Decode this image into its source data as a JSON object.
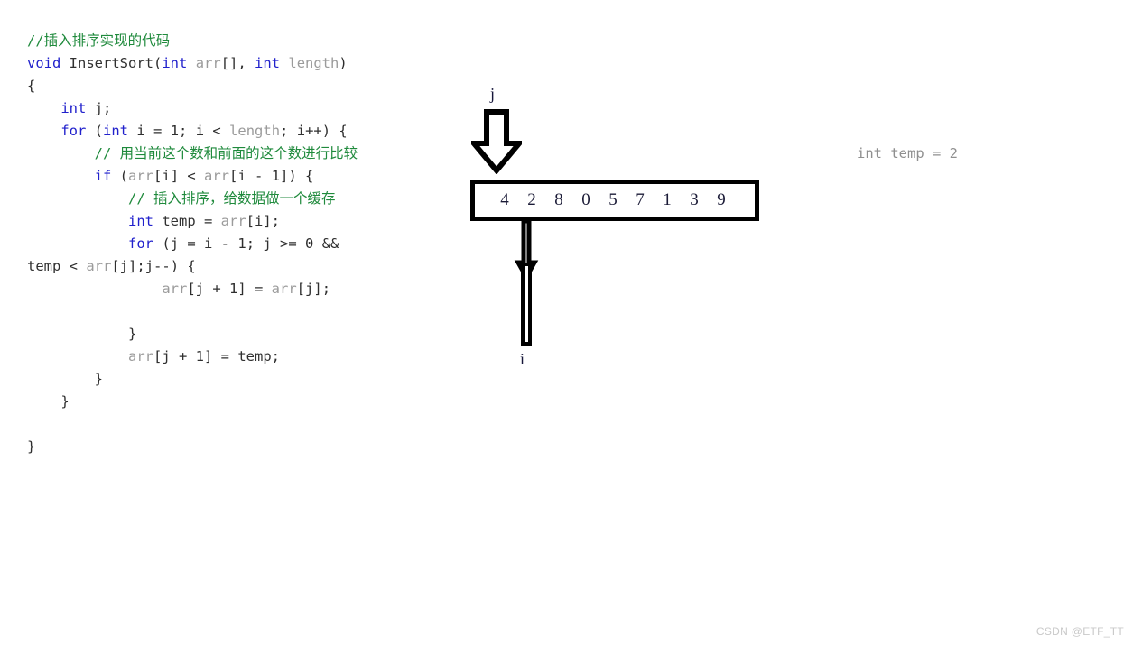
{
  "code": {
    "language": "c",
    "lines": [
      [
        {
          "t": "//插入排序实现的代码",
          "c": "cmt"
        }
      ],
      [
        {
          "t": "void",
          "c": "kw"
        },
        {
          "t": " ",
          "c": "pl"
        },
        {
          "t": "InsertSort",
          "c": "fn"
        },
        {
          "t": "(",
          "c": "pl"
        },
        {
          "t": "int",
          "c": "kw"
        },
        {
          "t": " ",
          "c": "pl"
        },
        {
          "t": "arr",
          "c": "id"
        },
        {
          "t": "[], ",
          "c": "pl"
        },
        {
          "t": "int",
          "c": "kw"
        },
        {
          "t": " ",
          "c": "pl"
        },
        {
          "t": "length",
          "c": "id"
        },
        {
          "t": ")",
          "c": "pl"
        }
      ],
      [
        {
          "t": "{",
          "c": "pl"
        }
      ],
      [
        {
          "t": "    ",
          "c": "pl"
        },
        {
          "t": "int",
          "c": "kw"
        },
        {
          "t": " ",
          "c": "pl"
        },
        {
          "t": "j",
          "c": "fn"
        },
        {
          "t": ";",
          "c": "pl"
        }
      ],
      [
        {
          "t": "    ",
          "c": "pl"
        },
        {
          "t": "for",
          "c": "kw"
        },
        {
          "t": " (",
          "c": "pl"
        },
        {
          "t": "int",
          "c": "kw"
        },
        {
          "t": " ",
          "c": "pl"
        },
        {
          "t": "i",
          "c": "fn"
        },
        {
          "t": " = ",
          "c": "pl"
        },
        {
          "t": "1",
          "c": "num"
        },
        {
          "t": "; ",
          "c": "pl"
        },
        {
          "t": "i",
          "c": "fn"
        },
        {
          "t": " < ",
          "c": "pl"
        },
        {
          "t": "length",
          "c": "id"
        },
        {
          "t": "; ",
          "c": "pl"
        },
        {
          "t": "i",
          "c": "fn"
        },
        {
          "t": "++) {",
          "c": "pl"
        }
      ],
      [
        {
          "t": "        ",
          "c": "pl"
        },
        {
          "t": "// 用当前这个数和前面的这个数进行比较",
          "c": "cmt"
        }
      ],
      [
        {
          "t": "        ",
          "c": "pl"
        },
        {
          "t": "if",
          "c": "kw"
        },
        {
          "t": " (",
          "c": "pl"
        },
        {
          "t": "arr",
          "c": "id"
        },
        {
          "t": "[",
          "c": "pl"
        },
        {
          "t": "i",
          "c": "fn"
        },
        {
          "t": "] < ",
          "c": "pl"
        },
        {
          "t": "arr",
          "c": "id"
        },
        {
          "t": "[",
          "c": "pl"
        },
        {
          "t": "i",
          "c": "fn"
        },
        {
          "t": " - ",
          "c": "pl"
        },
        {
          "t": "1",
          "c": "num"
        },
        {
          "t": "]) {",
          "c": "pl"
        }
      ],
      [
        {
          "t": "            ",
          "c": "pl"
        },
        {
          "t": "// 插入排序，给数据做一个缓存",
          "c": "cmt"
        }
      ],
      [
        {
          "t": "            ",
          "c": "pl"
        },
        {
          "t": "int",
          "c": "kw"
        },
        {
          "t": " ",
          "c": "pl"
        },
        {
          "t": "temp",
          "c": "fn"
        },
        {
          "t": " = ",
          "c": "pl"
        },
        {
          "t": "arr",
          "c": "id"
        },
        {
          "t": "[",
          "c": "pl"
        },
        {
          "t": "i",
          "c": "fn"
        },
        {
          "t": "];",
          "c": "pl"
        }
      ],
      [
        {
          "t": "            ",
          "c": "pl"
        },
        {
          "t": "for",
          "c": "kw"
        },
        {
          "t": " (",
          "c": "pl"
        },
        {
          "t": "j",
          "c": "fn"
        },
        {
          "t": " = ",
          "c": "pl"
        },
        {
          "t": "i",
          "c": "fn"
        },
        {
          "t": " - ",
          "c": "pl"
        },
        {
          "t": "1",
          "c": "num"
        },
        {
          "t": "; ",
          "c": "pl"
        },
        {
          "t": "j",
          "c": "fn"
        },
        {
          "t": " >= ",
          "c": "pl"
        },
        {
          "t": "0",
          "c": "num"
        },
        {
          "t": " && ",
          "c": "pl"
        },
        {
          "t": "temp",
          "c": "fn"
        },
        {
          "t": " < ",
          "c": "pl"
        },
        {
          "t": "arr",
          "c": "id"
        },
        {
          "t": "[",
          "c": "pl"
        },
        {
          "t": "j",
          "c": "fn"
        },
        {
          "t": "];",
          "c": "pl"
        },
        {
          "t": "j",
          "c": "fn"
        },
        {
          "t": "--) {",
          "c": "pl"
        }
      ],
      [
        {
          "t": "                ",
          "c": "pl"
        },
        {
          "t": "arr",
          "c": "id"
        },
        {
          "t": "[",
          "c": "pl"
        },
        {
          "t": "j",
          "c": "fn"
        },
        {
          "t": " + ",
          "c": "pl"
        },
        {
          "t": "1",
          "c": "num"
        },
        {
          "t": "] = ",
          "c": "pl"
        },
        {
          "t": "arr",
          "c": "id"
        },
        {
          "t": "[",
          "c": "pl"
        },
        {
          "t": "j",
          "c": "fn"
        },
        {
          "t": "];",
          "c": "pl"
        }
      ],
      [
        {
          "t": " ",
          "c": "pl"
        }
      ],
      [
        {
          "t": "            ",
          "c": "pl"
        },
        {
          "t": "}",
          "c": "pl"
        }
      ],
      [
        {
          "t": "            ",
          "c": "pl"
        },
        {
          "t": "arr",
          "c": "id"
        },
        {
          "t": "[",
          "c": "pl"
        },
        {
          "t": "j",
          "c": "fn"
        },
        {
          "t": " + ",
          "c": "pl"
        },
        {
          "t": "1",
          "c": "num"
        },
        {
          "t": "] = ",
          "c": "pl"
        },
        {
          "t": "temp",
          "c": "fn"
        },
        {
          "t": ";",
          "c": "pl"
        }
      ],
      [
        {
          "t": "        }",
          "c": "pl"
        }
      ],
      [
        {
          "t": "    }",
          "c": "pl"
        }
      ],
      [
        {
          "t": " ",
          "c": "pl"
        }
      ],
      [
        {
          "t": "}",
          "c": "pl"
        }
      ]
    ]
  },
  "array": {
    "values": [
      "4",
      "2",
      "8",
      "0",
      "5",
      "7",
      "1",
      "3",
      "9"
    ],
    "border_color": "#000000",
    "value_color": "#1a1a36"
  },
  "pointers": {
    "j": {
      "label": "j",
      "icon": "arrow-down-block-icon",
      "direction": "down",
      "target_index": 0
    },
    "i": {
      "label": "i",
      "icon": "arrow-up-thin-icon",
      "direction": "up",
      "target_index": 1
    }
  },
  "annotation": {
    "temp_text": "int temp = 2"
  },
  "watermark": {
    "text": "CSDN @ETF_TT"
  },
  "colors": {
    "comment": "#1f8a3c",
    "keyword": "#2121cc",
    "identifier": "#9b9b9b",
    "plain": "#2e2e2e",
    "annotation": "#8f8f8f",
    "watermark": "#c9c9c9"
  }
}
